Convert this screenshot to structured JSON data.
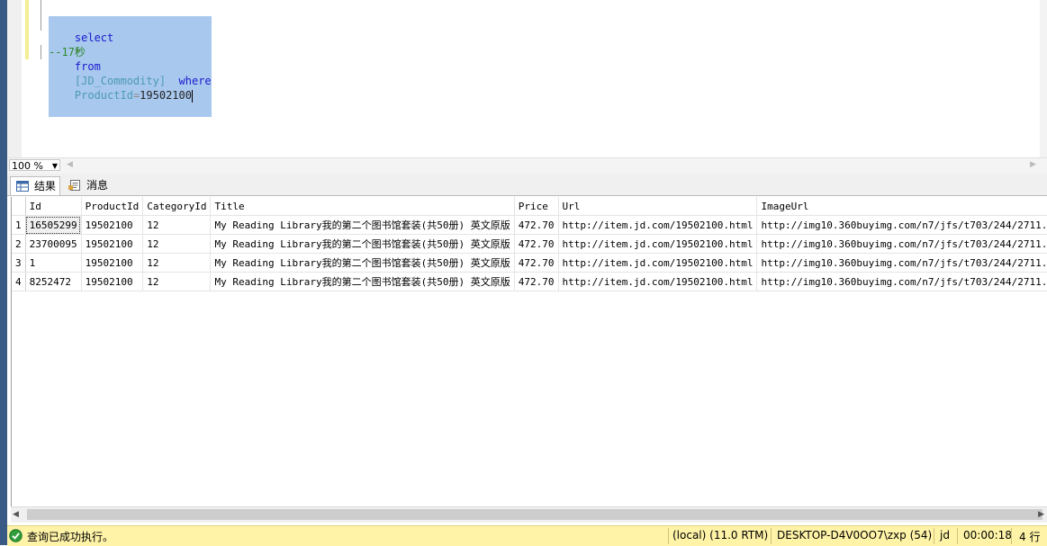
{
  "editor": {
    "query": {
      "select": "select",
      "star": "*",
      "from": "from",
      "table": "[JD_Commodity]",
      "where": "where",
      "column": "ProductId",
      "equals": "=",
      "value": "19502100"
    },
    "comment": "--17秒"
  },
  "zoom": {
    "value": "100 %"
  },
  "tabs": [
    {
      "label": "结果",
      "icon": "grid-icon"
    },
    {
      "label": "消息",
      "icon": "message-icon"
    }
  ],
  "results": {
    "columns": [
      "Id",
      "ProductId",
      "CategoryId",
      "Title",
      "Price",
      "Url",
      "ImageUrl"
    ],
    "rows": [
      {
        "num": "1",
        "cells": [
          "16505299",
          "19502100",
          "12",
          "My Reading Library我的第二个图书馆套装(共50册) 英文原版",
          "472.70",
          "http://item.jd.com/19502100.html",
          "http://img10.360buyimg.com/n7/jfs/t703/244/2711..."
        ]
      },
      {
        "num": "2",
        "cells": [
          "23700095",
          "19502100",
          "12",
          "My Reading Library我的第二个图书馆套装(共50册) 英文原版",
          "472.70",
          "http://item.jd.com/19502100.html",
          "http://img10.360buyimg.com/n7/jfs/t703/244/2711..."
        ]
      },
      {
        "num": "3",
        "cells": [
          "1",
          "19502100",
          "12",
          "My Reading Library我的第二个图书馆套装(共50册) 英文原版",
          "472.70",
          "http://item.jd.com/19502100.html",
          "http://img10.360buyimg.com/n7/jfs/t703/244/2711..."
        ]
      },
      {
        "num": "4",
        "cells": [
          "8252472",
          "19502100",
          "12",
          "My Reading Library我的第二个图书馆套装(共50册) 英文原版",
          "472.70",
          "http://item.jd.com/19502100.html",
          "http://img10.360buyimg.com/n7/jfs/t703/244/2711..."
        ]
      }
    ]
  },
  "status": {
    "message": "查询已成功执行。",
    "server": "(local) (11.0 RTM)",
    "user": "DESKTOP-D4V0OO7\\zxp (54)",
    "database": "jd",
    "elapsed": "00:00:18",
    "row_count": "4 行",
    "icon": "success-check-icon"
  },
  "colors": {
    "status_bar": "#fff3a8",
    "selection": "#a8c8ee",
    "keyword": "#1a1acd",
    "identifier": "#4c9ab4",
    "comment": "#2a8a2a"
  }
}
